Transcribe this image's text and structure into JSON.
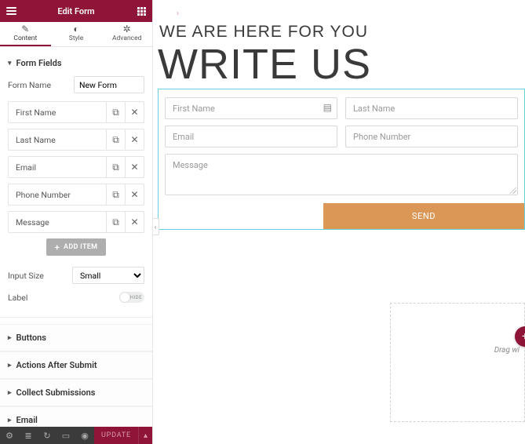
{
  "header": {
    "title": "Edit Form"
  },
  "tabs": {
    "content": "Content",
    "style": "Style",
    "advanced": "Advanced"
  },
  "formFieldsSection": {
    "heading": "Form Fields",
    "formNameLabel": "Form Name",
    "formNameValue": "New Form",
    "fields": [
      "First Name",
      "Last Name",
      "Email",
      "Phone Number",
      "Message"
    ],
    "addItem": "ADD ITEM",
    "inputSizeLabel": "Input Size",
    "inputSizeValue": "Small",
    "labelLabel": "Label",
    "labelToggleText": "HIDE"
  },
  "sections": {
    "buttons": "Buttons",
    "actions": "Actions After Submit",
    "collect": "Collect Submissions",
    "email": "Email"
  },
  "footer": {
    "update": "UPDATE"
  },
  "canvas": {
    "pretitle": "WE ARE HERE FOR YOU",
    "title": "WRITE US",
    "placeholders": {
      "first": "First Name",
      "last": "Last Name",
      "email": "Email",
      "phone": "Phone Number",
      "message": "Message"
    },
    "send": "SEND",
    "dragText": "Drag wi"
  }
}
